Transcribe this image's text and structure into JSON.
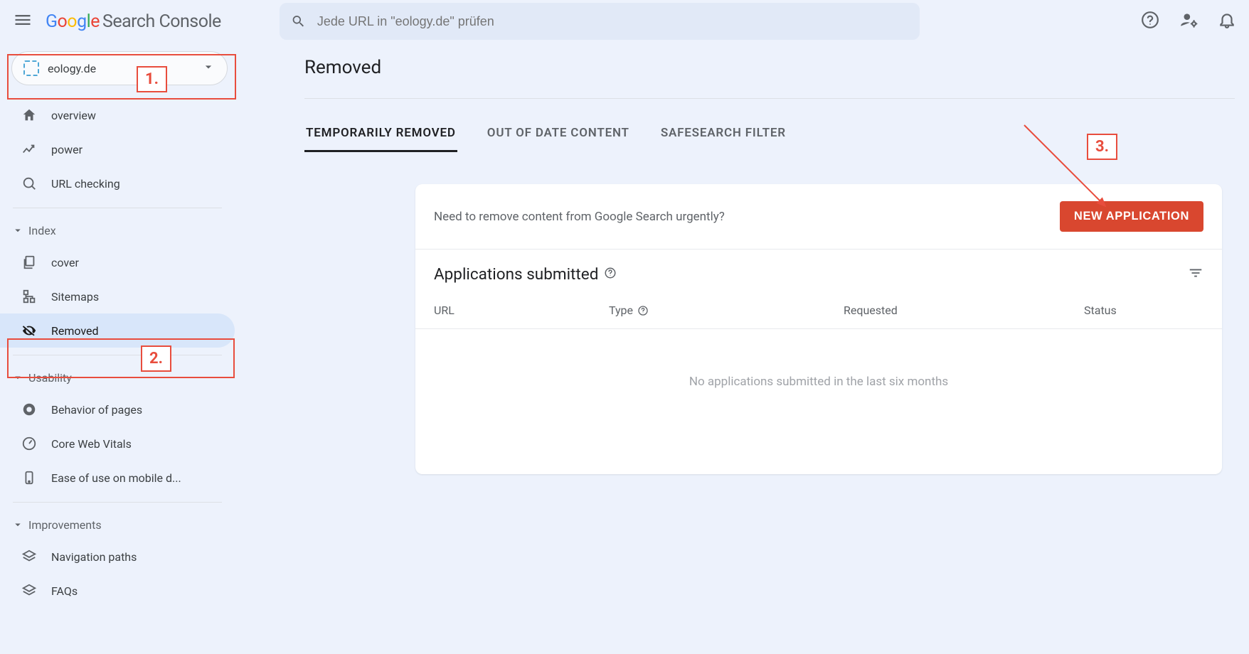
{
  "header": {
    "product_name": "Search Console",
    "search_placeholder": "Jede URL in \"eology.de\" prüfen"
  },
  "property": {
    "name": "eology.de"
  },
  "sidebar": {
    "overview": "overview",
    "power": "power",
    "url_checking": "URL checking",
    "index_group": "Index",
    "cover": "cover",
    "sitemaps": "Sitemaps",
    "removed": "Removed",
    "usability_group": "Usability",
    "behavior": "Behavior of pages",
    "cwv": "Core Web Vitals",
    "mobile": "Ease of use on mobile d...",
    "improvements_group": "Improvements",
    "navpaths": "Navigation paths",
    "faqs": "FAQs"
  },
  "page": {
    "title": "Removed",
    "tabs": {
      "temp": "TEMPORARILY REMOVED",
      "outdated": "OUT OF DATE CONTENT",
      "safesearch": "SAFESEARCH FILTER"
    }
  },
  "card": {
    "prompt": "Need to remove content from Google Search urgently?",
    "new_button": "NEW APPLICATION",
    "section_title": "Applications submitted",
    "columns": {
      "url": "URL",
      "type": "Type",
      "requested": "Requested",
      "status": "Status"
    },
    "empty": "No applications submitted in the last six months"
  },
  "annotations": {
    "a1": "1.",
    "a2": "2.",
    "a3": "3."
  },
  "colors": {
    "accent_red": "#d9472f",
    "annotation": "#e84d3d"
  }
}
